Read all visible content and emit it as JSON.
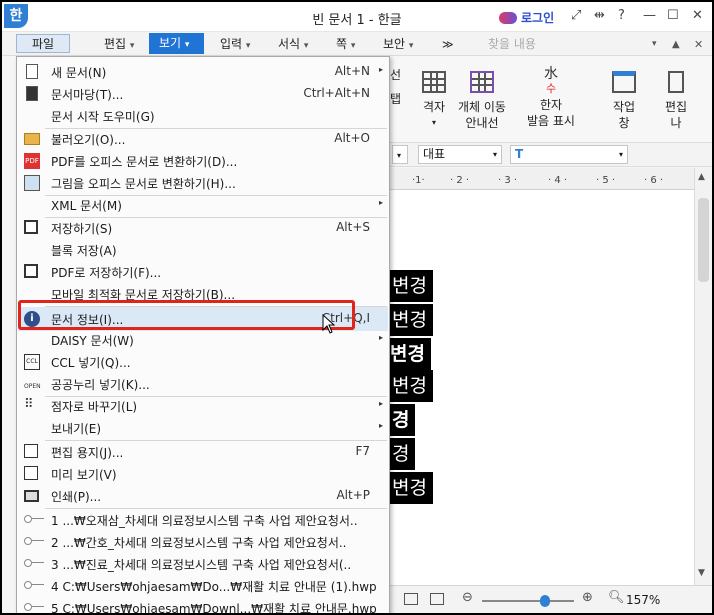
{
  "window": {
    "title": "빈 문서 1 - 한글",
    "app_icon": "한",
    "login_label": "로그인"
  },
  "menubar": {
    "items": [
      "파일",
      "편집",
      "보기",
      "입력",
      "서식",
      "쪽",
      "보안"
    ],
    "search_placeholder": "찾을 내용",
    "overflow": "≫"
  },
  "ribbon": {
    "items": [
      {
        "label": "선",
        "sub": "탭"
      },
      {
        "label": "격자"
      },
      {
        "label": "개체 이동",
        "sub": "안내선"
      },
      {
        "label": "한자",
        "sub": "발음 표시"
      },
      {
        "label": "작업",
        "sub": "창"
      },
      {
        "label": "편집",
        "sub": "나"
      }
    ]
  },
  "formatbar": {
    "style": "대표",
    "font_icon": "T"
  },
  "document": {
    "lines": [
      "변경",
      "변경",
      "변경",
      "변경",
      "경",
      "경",
      "변경"
    ]
  },
  "statusbar": {
    "zoom": "157%"
  },
  "file_menu": {
    "items": [
      {
        "label": "새 문서(N)",
        "shortcut": "Alt+N",
        "icon": "new-doc-icon",
        "arrow": "▸"
      },
      {
        "label": "문서마당(T)...",
        "shortcut": "Ctrl+Alt+N",
        "icon": "template-icon"
      },
      {
        "label": "문서 시작 도우미(G)",
        "shortcut": "",
        "icon": ""
      },
      {
        "label": "불러오기(O)...",
        "shortcut": "Alt+O",
        "icon": "open-folder-icon"
      },
      {
        "label": "PDF를 오피스 문서로 변환하기(D)...",
        "shortcut": "",
        "icon": "pdf-icon"
      },
      {
        "label": "그림을 오피스 문서로 변환하기(H)...",
        "shortcut": "",
        "icon": "image-convert-icon"
      },
      {
        "label": "XML 문서(M)",
        "shortcut": "",
        "icon": "",
        "arrow": "▸"
      },
      {
        "label": "저장하기(S)",
        "shortcut": "Alt+S",
        "icon": "save-icon"
      },
      {
        "label": "블록 저장(A)",
        "shortcut": "",
        "icon": ""
      },
      {
        "label": "PDF로 저장하기(F)...",
        "shortcut": "",
        "icon": "save-pdf-icon"
      },
      {
        "label": "모바일 최적화 문서로 저장하기(B)...",
        "shortcut": "",
        "icon": ""
      },
      {
        "label": "문서 정보(I)...",
        "shortcut": "Ctrl+Q,I",
        "icon": "info-icon"
      },
      {
        "label": "DAISY 문서(W)",
        "shortcut": "",
        "icon": "",
        "arrow": "▸"
      },
      {
        "label": "CCL 넣기(Q)...",
        "shortcut": "",
        "icon": "ccl-icon"
      },
      {
        "label": "공공누리 넣기(K)...",
        "shortcut": "",
        "icon": "open-license-icon"
      },
      {
        "label": "점자로 바꾸기(L)",
        "shortcut": "",
        "icon": "braille-icon",
        "arrow": "▸"
      },
      {
        "label": "보내기(E)",
        "shortcut": "",
        "icon": "",
        "arrow": "▸"
      },
      {
        "label": "편집 용지(J)...",
        "shortcut": "F7",
        "icon": "page-setup-icon"
      },
      {
        "label": "미리 보기(V)",
        "shortcut": "",
        "icon": "preview-icon"
      },
      {
        "label": "인쇄(P)...",
        "shortcut": "Alt+P",
        "icon": "print-icon"
      }
    ],
    "recent": [
      "1 ...₩오재삼_차세대 의료정보시스템 구축 사업 제안요청서..",
      "2 ...₩간호_차세대 의료정보시스템 구축 사업 제안요청서..",
      "3 ...₩진료_차세대 의료정보시스템 구축 사업 제안요청서(..",
      "4 C:₩Users₩ohjaesam₩Do...₩재활 치료 안내문 (1).hwp",
      "5 C:₩Users₩ohjaesam₩Downl...₩재활 치료 안내문.hwp"
    ]
  },
  "colors": {
    "accent": "#1f74d4",
    "highlight_box": "#e2231a",
    "login": "#2a4fd0"
  }
}
